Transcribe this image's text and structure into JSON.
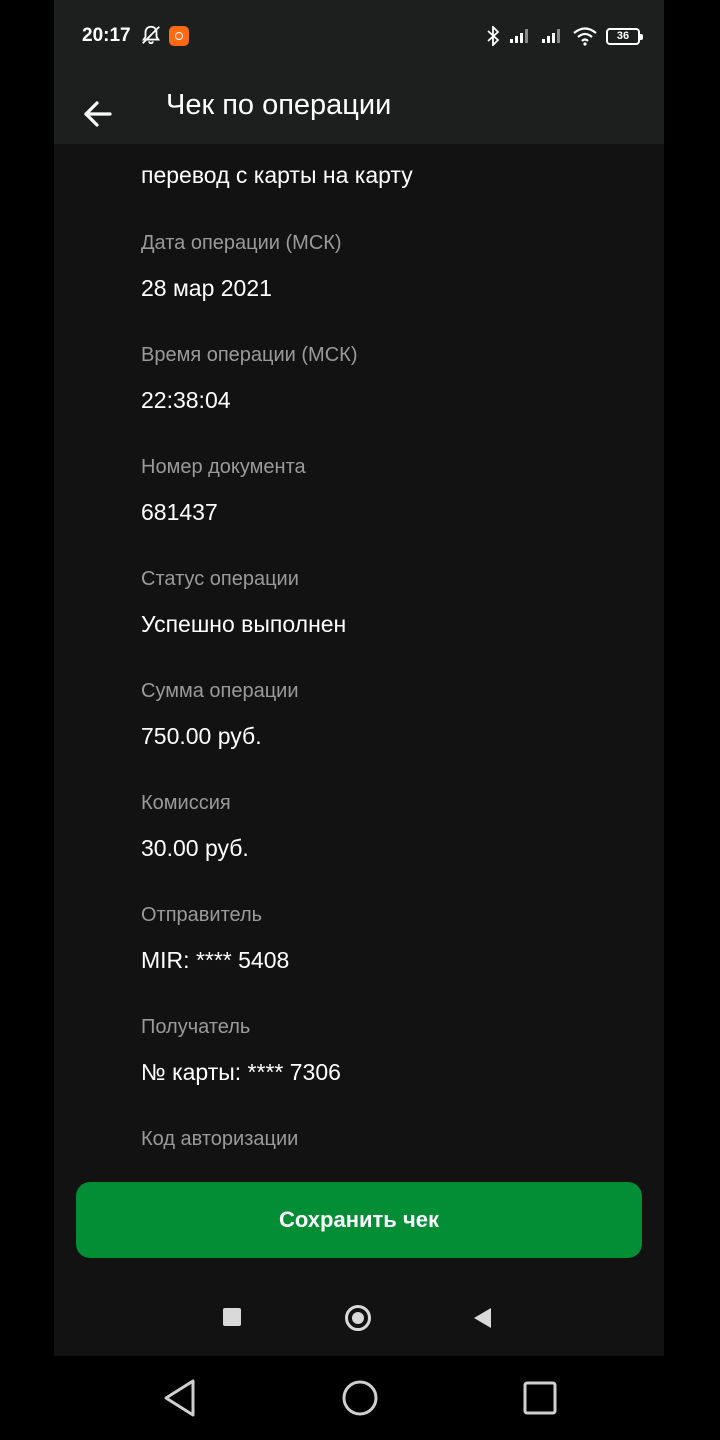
{
  "status_bar": {
    "time": "20:17",
    "battery": "36"
  },
  "app_bar": {
    "title": "Чек по операции"
  },
  "operation_type": "перевод с карты на карту",
  "fields": [
    {
      "label": "Дата операции (МСК)",
      "value": "28 мар 2021"
    },
    {
      "label": "Время операции (МСК)",
      "value": "22:38:04"
    },
    {
      "label": "Номер документа",
      "value": "681437"
    },
    {
      "label": "Статус операции",
      "value": "Успешно выполнен"
    },
    {
      "label": "Сумма операции",
      "value": "750.00 руб."
    },
    {
      "label": "Комиссия",
      "value": "30.00 руб."
    },
    {
      "label": "Отправитель",
      "value": "MIR: **** 5408"
    },
    {
      "label": "Получатель",
      "value": "№ карты: **** 7306"
    },
    {
      "label": "Код авторизации",
      "value": ""
    }
  ],
  "save_button": {
    "label": "Сохранить чек"
  },
  "colors": {
    "accent_green": "#038e36",
    "background": "#121212",
    "appbar": "#1c1f1d"
  }
}
